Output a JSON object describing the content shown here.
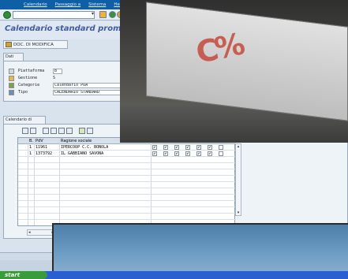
{
  "menu": [
    "Calendario",
    "Passaggio a",
    "Sistema",
    "Help"
  ],
  "title": "Calendario standard promozionale",
  "toolbar": {
    "doc_button": "DOC. DI MODIFICA"
  },
  "tabs": {
    "general": "Dati generali",
    "calendar": "Calendario di consegna"
  },
  "general_fields": [
    {
      "label": "Piattaforma",
      "value": "B"
    },
    {
      "label": "Gestione",
      "value": "S"
    },
    {
      "label": "Categorie",
      "value": "Calendario POA"
    },
    {
      "label": "Tipo",
      "value": "CALENDARIO STANDARD"
    }
  ],
  "grid": {
    "headers": [
      "B.",
      "PdV",
      "Ragione sociale"
    ],
    "rows": [
      {
        "b": "1",
        "pdv": "11961",
        "ragione": "IPERCOOP C.C. BONOLA"
      },
      {
        "b": "1",
        "pdv": "1373792",
        "ragione": "IL GABBIANO SAVONA"
      }
    ]
  },
  "taskbar": {
    "start": "start"
  },
  "colors": {
    "title": "#3f5aa3",
    "menubar": "#0f5fa6",
    "taskbar": "#2a5fd1",
    "start": "#3a9b3a"
  }
}
